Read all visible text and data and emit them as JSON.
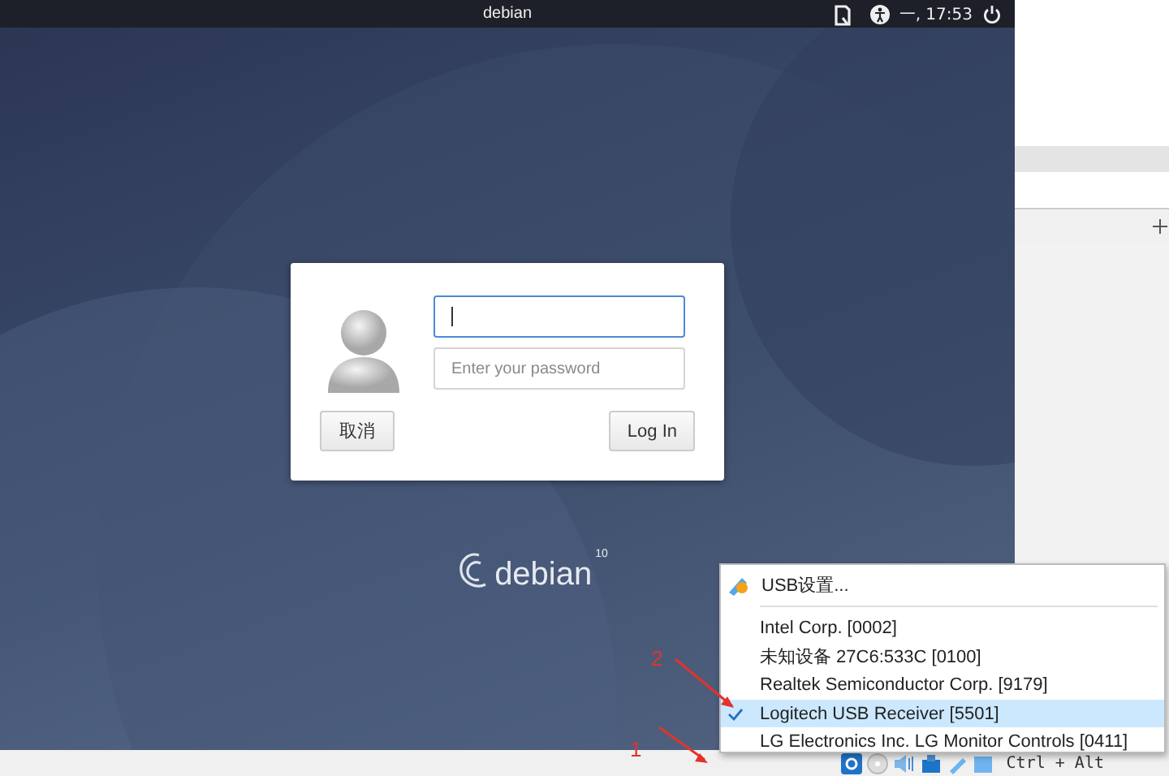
{
  "topbar": {
    "title": "debian",
    "time": "一, 17:53"
  },
  "login": {
    "password": {
      "placeholder": "Enter your password"
    },
    "buttons": [
      {
        "label": "取消",
        "kind": "cancel"
      },
      {
        "label": "Log In",
        "kind": "submit"
      }
    ]
  },
  "logo": {
    "name": "debian",
    "version": "10"
  },
  "usb_menu": {
    "header": "USB设置...",
    "devices": [
      {
        "label": "Intel Corp.  [0002]",
        "checked": false
      },
      {
        "label": "未知设备 27C6:533C [0100]",
        "checked": false
      },
      {
        "label": "Realtek Semiconductor Corp.  [9179]",
        "checked": false
      },
      {
        "label": "Logitech USB Receiver [5501]",
        "checked": true
      },
      {
        "label": "LG Electronics Inc. LG Monitor Controls [0411]",
        "checked": false
      }
    ]
  },
  "status_bar": {
    "keys": "Ctrl + Alt"
  },
  "annotations": [
    "2",
    "1"
  ]
}
